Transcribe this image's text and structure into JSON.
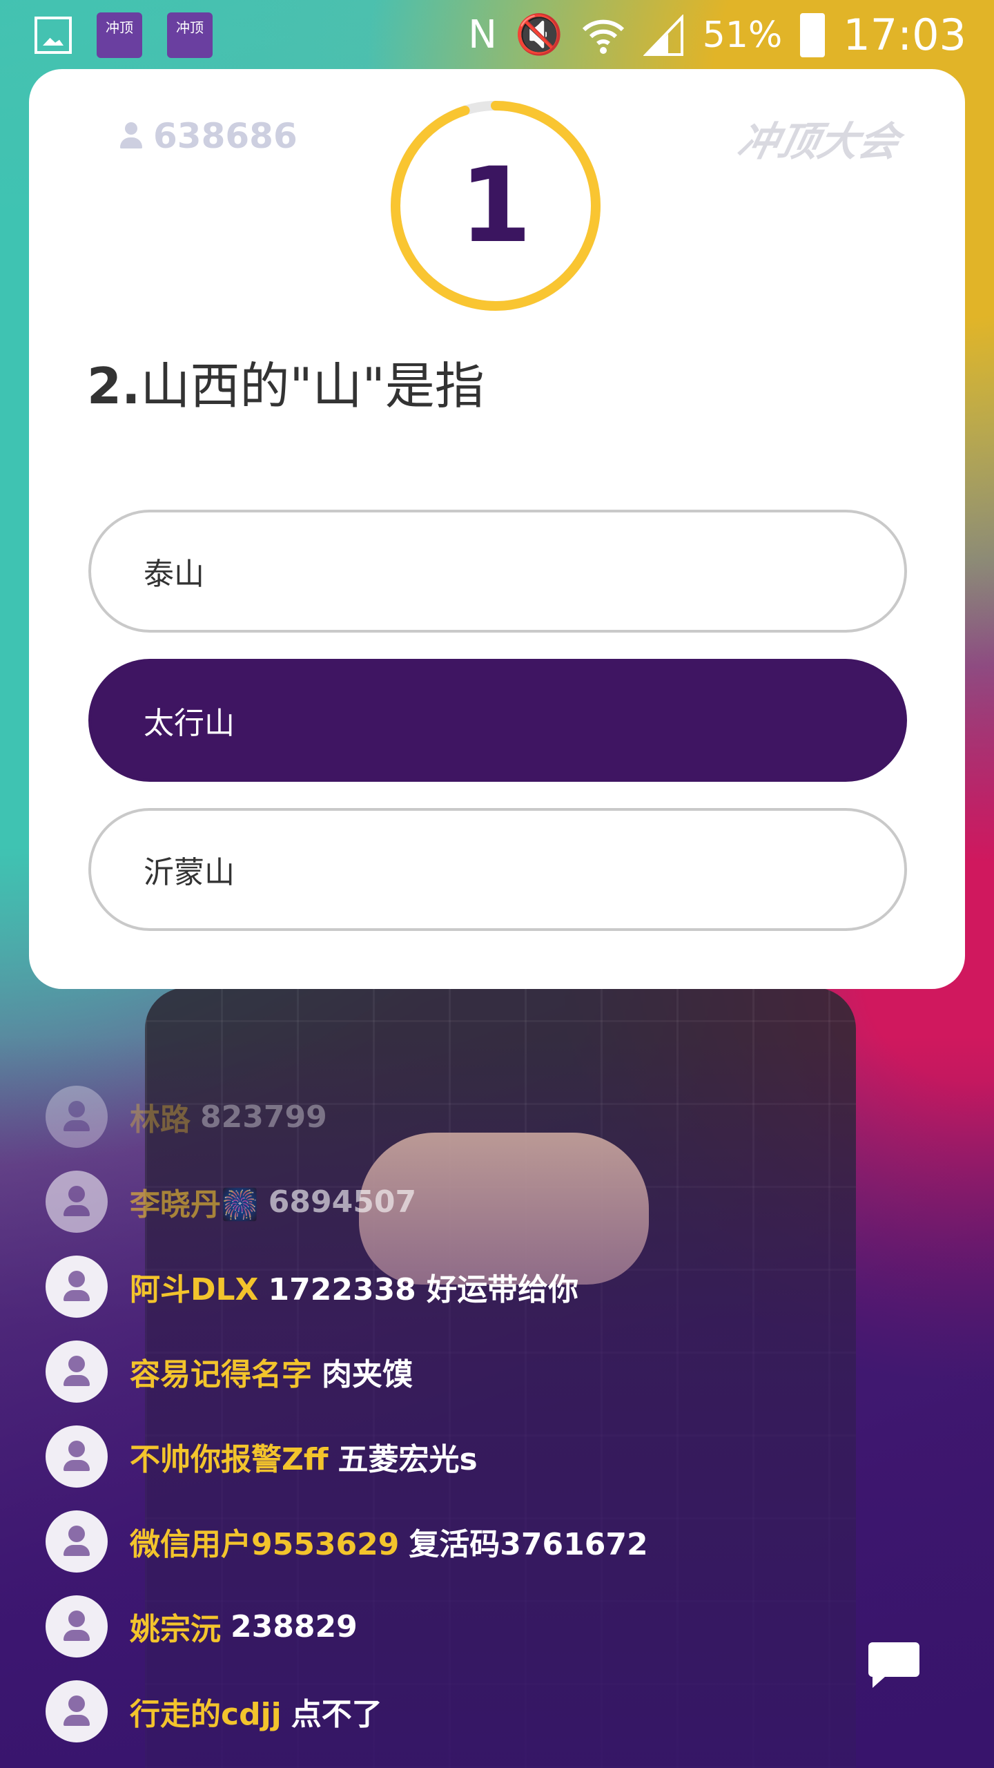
{
  "status_bar": {
    "battery": "51%",
    "time": "17:03",
    "app_icon_text": "冲顶",
    "icons": [
      "gallery-icon",
      "app-icon",
      "app-icon",
      "nfc-icon",
      "mute-icon",
      "wifi-icon",
      "signal-icon",
      "battery-icon"
    ]
  },
  "quiz": {
    "viewer_count": "638686",
    "logo_text": "冲顶大会",
    "timer_value": "1",
    "timer_progress": 0.95,
    "question_number": "2.",
    "question_text": "山西的\"山\"是指",
    "options": [
      {
        "label": "泰山",
        "selected": false
      },
      {
        "label": "太行山",
        "selected": true
      },
      {
        "label": "沂蒙山",
        "selected": false
      }
    ]
  },
  "comments": [
    {
      "name": "林路",
      "text": "823799"
    },
    {
      "name": "李晓丹🎆",
      "text": "6894507"
    },
    {
      "name": "阿斗DLX",
      "text": "1722338 好运带给你"
    },
    {
      "name": "容易记得名字",
      "text": "肉夹馍"
    },
    {
      "name": "不帅你报警Zff",
      "text": "五菱宏光s"
    },
    {
      "name": "微信用户9553629",
      "text": "复活码3761672"
    },
    {
      "name": "姚宗沅",
      "text": "238829"
    },
    {
      "name": "行走的cdjj",
      "text": "点不了"
    }
  ],
  "colors": {
    "accent_purple": "#3f1562",
    "timer_ring": "#f9c531",
    "comment_name": "#f3c42c"
  }
}
